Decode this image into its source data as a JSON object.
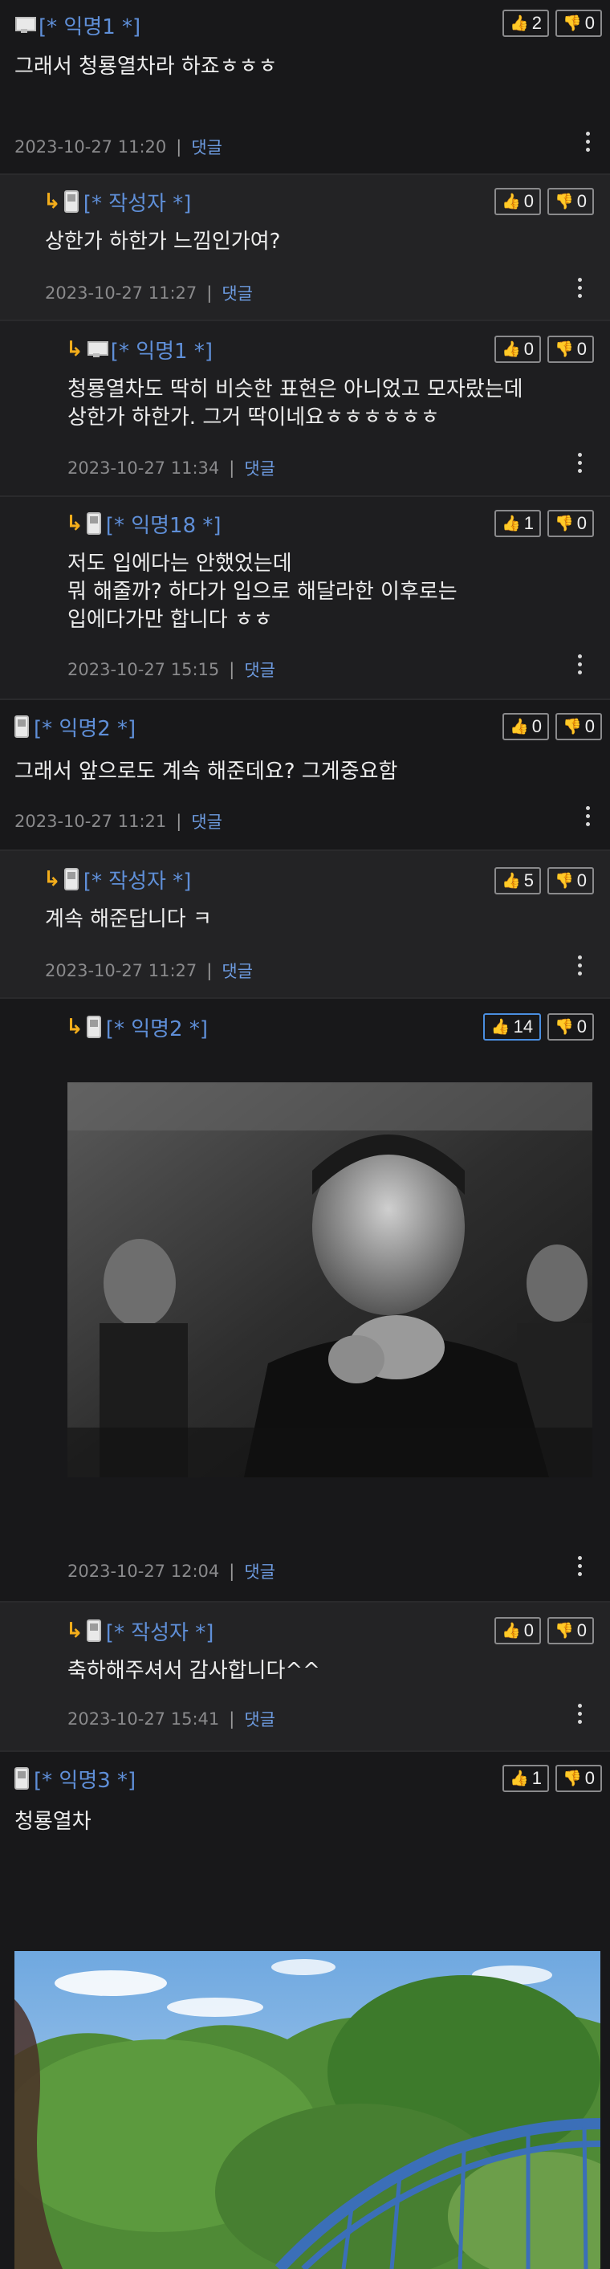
{
  "comments": [
    {
      "nick": "[* 익명1 *]",
      "device": "pc",
      "likes": "2",
      "dislikes": "0",
      "lines": [
        "그래서 청룡열차라 하죠ㅎㅎㅎ"
      ],
      "date": "2023-10-27 11:20",
      "reply": "댓글"
    },
    {
      "nick": "[* 작성자 *]",
      "device": "mobile",
      "likes": "0",
      "dislikes": "0",
      "lines": [
        "상한가 하한가 느낌인가여?"
      ],
      "date": "2023-10-27 11:27",
      "reply": "댓글"
    },
    {
      "nick": "[* 익명1 *]",
      "device": "pc",
      "likes": "0",
      "dislikes": "0",
      "lines": [
        "청룡열차도 딱히 비슷한 표현은 아니었고 모자랐는데",
        "상한가 하한가. 그거 딱이네요ㅎㅎㅎㅎㅎㅎ"
      ],
      "date": "2023-10-27 11:34",
      "reply": "댓글"
    },
    {
      "nick": "[* 익명18 *]",
      "device": "mobile",
      "likes": "1",
      "dislikes": "0",
      "lines": [
        "저도 입에다는 안했었는데",
        "뭐 해줄까? 하다가 입으로 해달라한 이후로는",
        "입에다가만 합니다 ㅎㅎ"
      ],
      "date": "2023-10-27 15:15",
      "reply": "댓글"
    },
    {
      "nick": "[* 익명2 *]",
      "device": "mobile",
      "likes": "0",
      "dislikes": "0",
      "lines": [
        "그래서 앞으로도 계속 해준데요?  그게중요함"
      ],
      "date": "2023-10-27 11:21",
      "reply": "댓글"
    },
    {
      "nick": "[* 작성자 *]",
      "device": "mobile",
      "likes": "5",
      "dislikes": "0",
      "lines": [
        "계속 해준답니다 ㅋ"
      ],
      "date": "2023-10-27 11:27",
      "reply": "댓글"
    },
    {
      "nick": "[* 익명2 *]",
      "device": "mobile",
      "likes": "14",
      "dislikes": "0",
      "lines": [],
      "date": "2023-10-27 12:04",
      "reply": "댓글"
    },
    {
      "nick": "[* 작성자 *]",
      "device": "mobile",
      "likes": "0",
      "dislikes": "0",
      "lines": [
        "축하해주셔서 감사합니다^^"
      ],
      "date": "2023-10-27 15:41",
      "reply": "댓글"
    },
    {
      "nick": "[* 익명3 *]",
      "device": "mobile",
      "likes": "1",
      "dislikes": "0",
      "lines": [
        "청룡열차"
      ],
      "date": "",
      "reply": ""
    }
  ],
  "colors": {
    "nick": "#5f8fd8",
    "reply_arrow": "#f3ad1b",
    "reply_link": "#6d9be0",
    "vote_highlight": "#4a8ee0"
  },
  "icons": {
    "reply": "reply-arrow-icon",
    "pc": "pc-monitor-icon",
    "mobile": "mobile-phone-icon",
    "like": "thumbs-up-icon",
    "dislike": "thumbs-down-icon",
    "more": "kebab-menu-icon"
  }
}
